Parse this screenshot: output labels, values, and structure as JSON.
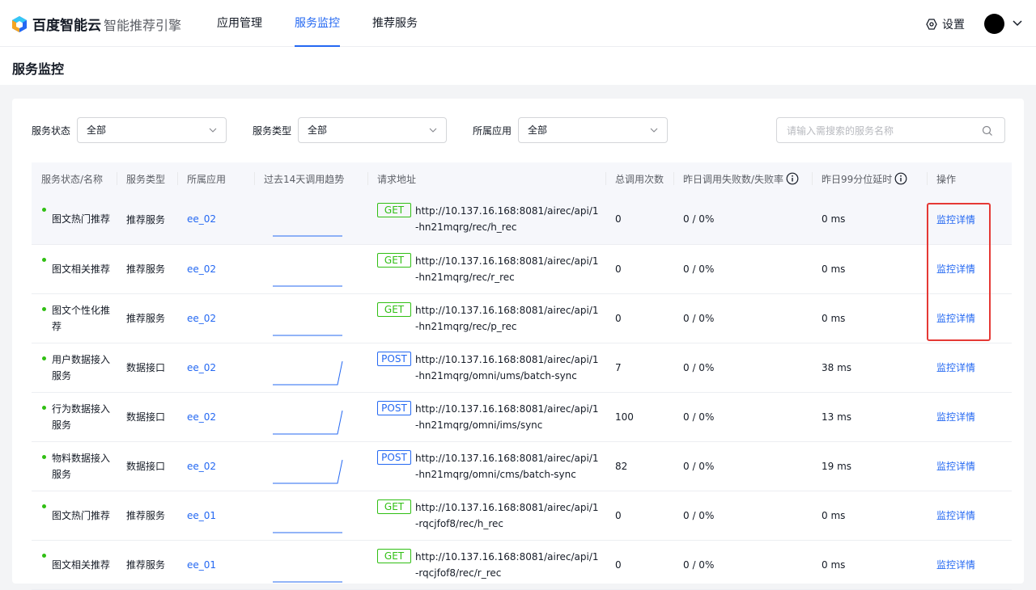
{
  "brand": {
    "logo_text": "百度智能云",
    "product_name": "智能推荐引擎"
  },
  "nav": [
    {
      "label": "应用管理",
      "active": false
    },
    {
      "label": "服务监控",
      "active": true
    },
    {
      "label": "推荐服务",
      "active": false
    }
  ],
  "header_right": {
    "settings_label": "设置",
    "settings_icon": "settings-icon",
    "avatar": "user-avatar"
  },
  "page": {
    "title": "服务监控"
  },
  "filters": {
    "status": {
      "label": "服务状态",
      "value": "全部"
    },
    "type": {
      "label": "服务类型",
      "value": "全部"
    },
    "app": {
      "label": "所属应用",
      "value": "全部"
    },
    "search": {
      "placeholder": "请输入需搜索的服务名称",
      "value": ""
    }
  },
  "table": {
    "columns": [
      "服务状态/名称",
      "服务类型",
      "所属应用",
      "过去14天调用趋势",
      "请求地址",
      "总调用次数",
      "昨日调用失败数/失败率",
      "昨日99分位延时",
      "操作"
    ],
    "rows": [
      {
        "status": "running",
        "name": "图文热门推荐",
        "type": "推荐服务",
        "app": "ee_02",
        "trend": "flat",
        "method": "GET",
        "url": "http://10.137.16.168:8081/airec/api/1-hn21mqrg/rec/h_rec",
        "total_calls": "0",
        "failures": "0 / 0%",
        "p99": "0 ms",
        "action": "监控详情"
      },
      {
        "status": "running",
        "name": "图文相关推荐",
        "type": "推荐服务",
        "app": "ee_02",
        "trend": "flat",
        "method": "GET",
        "url": "http://10.137.16.168:8081/airec/api/1-hn21mqrg/rec/r_rec",
        "total_calls": "0",
        "failures": "0 / 0%",
        "p99": "0 ms",
        "action": "监控详情"
      },
      {
        "status": "running",
        "name": "图文个性化推荐",
        "type": "推荐服务",
        "app": "ee_02",
        "trend": "flat",
        "method": "GET",
        "url": "http://10.137.16.168:8081/airec/api/1-hn21mqrg/rec/p_rec",
        "total_calls": "0",
        "failures": "0 / 0%",
        "p99": "0 ms",
        "action": "监控详情"
      },
      {
        "status": "running",
        "name": "用户数据接入服务",
        "type": "数据接口",
        "app": "ee_02",
        "trend": "rise",
        "method": "POST",
        "url": "http://10.137.16.168:8081/airec/api/1-hn21mqrg/omni/ums/batch-sync",
        "total_calls": "7",
        "failures": "0 / 0%",
        "p99": "38 ms",
        "action": "监控详情"
      },
      {
        "status": "running",
        "name": "行为数据接入服务",
        "type": "数据接口",
        "app": "ee_02",
        "trend": "rise",
        "method": "POST",
        "url": "http://10.137.16.168:8081/airec/api/1-hn21mqrg/omni/ims/sync",
        "total_calls": "100",
        "failures": "0 / 0%",
        "p99": "13 ms",
        "action": "监控详情"
      },
      {
        "status": "running",
        "name": "物料数据接入服务",
        "type": "数据接口",
        "app": "ee_02",
        "trend": "rise",
        "method": "POST",
        "url": "http://10.137.16.168:8081/airec/api/1-hn21mqrg/omni/cms/batch-sync",
        "total_calls": "82",
        "failures": "0 / 0%",
        "p99": "19 ms",
        "action": "监控详情"
      },
      {
        "status": "running",
        "name": "图文热门推荐",
        "type": "推荐服务",
        "app": "ee_01",
        "trend": "flat",
        "method": "GET",
        "url": "http://10.137.16.168:8081/airec/api/1-rqcjfof8/rec/h_rec",
        "total_calls": "0",
        "failures": "0 / 0%",
        "p99": "0 ms",
        "action": "监控详情"
      },
      {
        "status": "running",
        "name": "图文相关推荐",
        "type": "推荐服务",
        "app": "ee_01",
        "trend": "flat",
        "method": "GET",
        "url": "http://10.137.16.168:8081/airec/api/1-rqcjfof8/rec/r_rec",
        "total_calls": "0",
        "failures": "0 / 0%",
        "p99": "0 ms",
        "action": "监控详情"
      }
    ]
  },
  "colors": {
    "primary": "#2468f2",
    "status_running": "#30bf13",
    "get_method": "#30bf13",
    "post_method": "#2468f2",
    "highlight_box": "#e53935"
  }
}
